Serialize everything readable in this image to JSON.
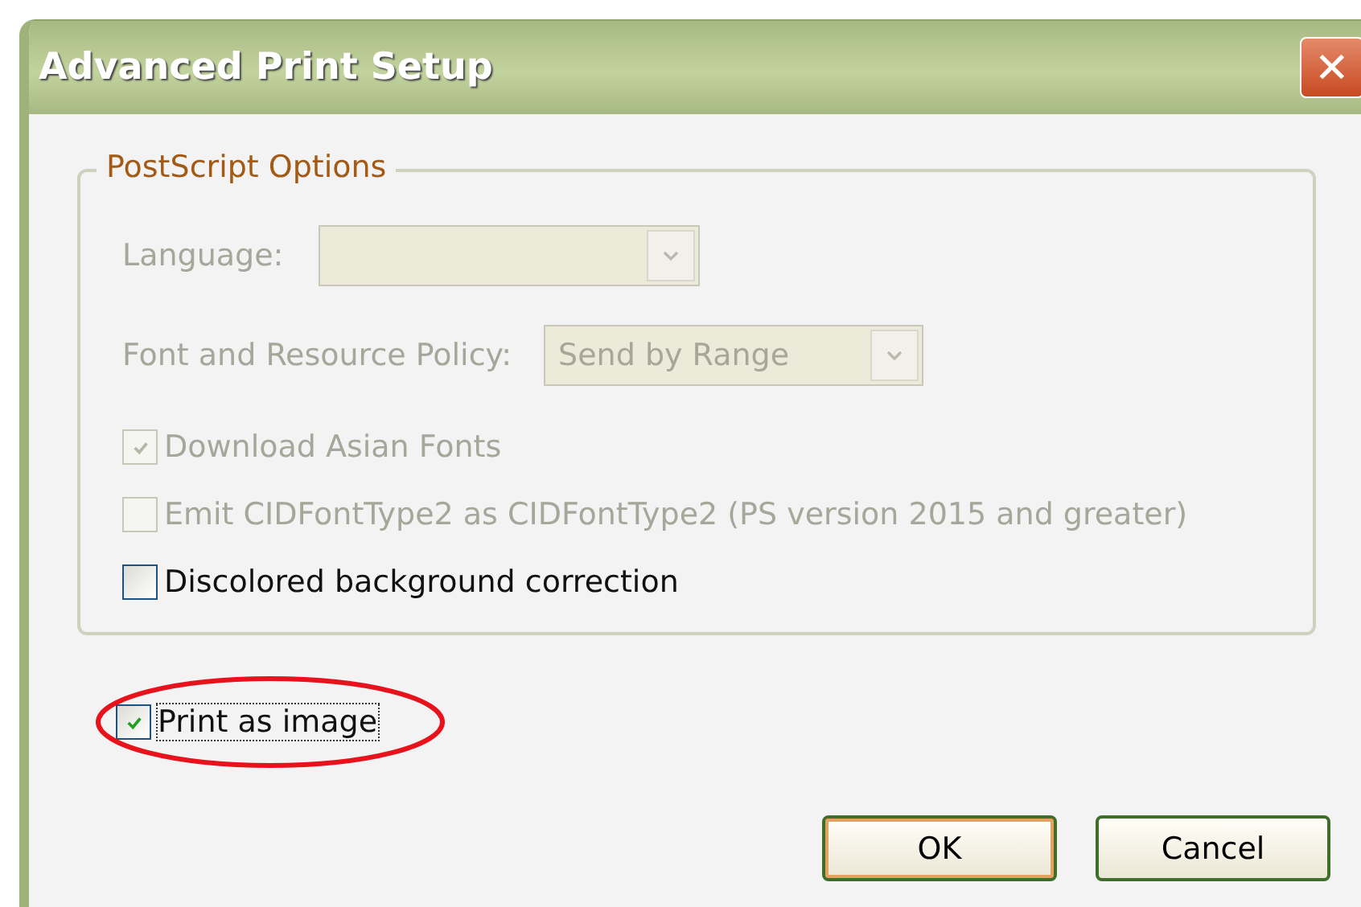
{
  "window": {
    "title": "Advanced Print Setup",
    "close": "✕"
  },
  "group": {
    "title": "PostScript Options",
    "dropdowns": [
      {
        "label": "Language:",
        "disabled": true
      },
      {
        "label": "Font and Resource Policy:",
        "value": "Send by Range",
        "disabled": true
      }
    ],
    "checkboxes": [
      {
        "label": "Download Asian Fonts",
        "checked": true,
        "disabled": true
      },
      {
        "label": "Emit CIDFontType2 as CIDFontType2 (PS version 2015 and greater)",
        "checked": false,
        "disabled": true
      },
      {
        "label": "Discolored background correction",
        "checked": false,
        "disabled": false
      }
    ]
  },
  "print_as_image": {
    "label": "Print as image",
    "checked": true,
    "disabled": false,
    "highlighted": true
  },
  "buttons": [
    {
      "label": "OK",
      "default": true
    },
    {
      "label": "Cancel",
      "default": false
    }
  ]
}
